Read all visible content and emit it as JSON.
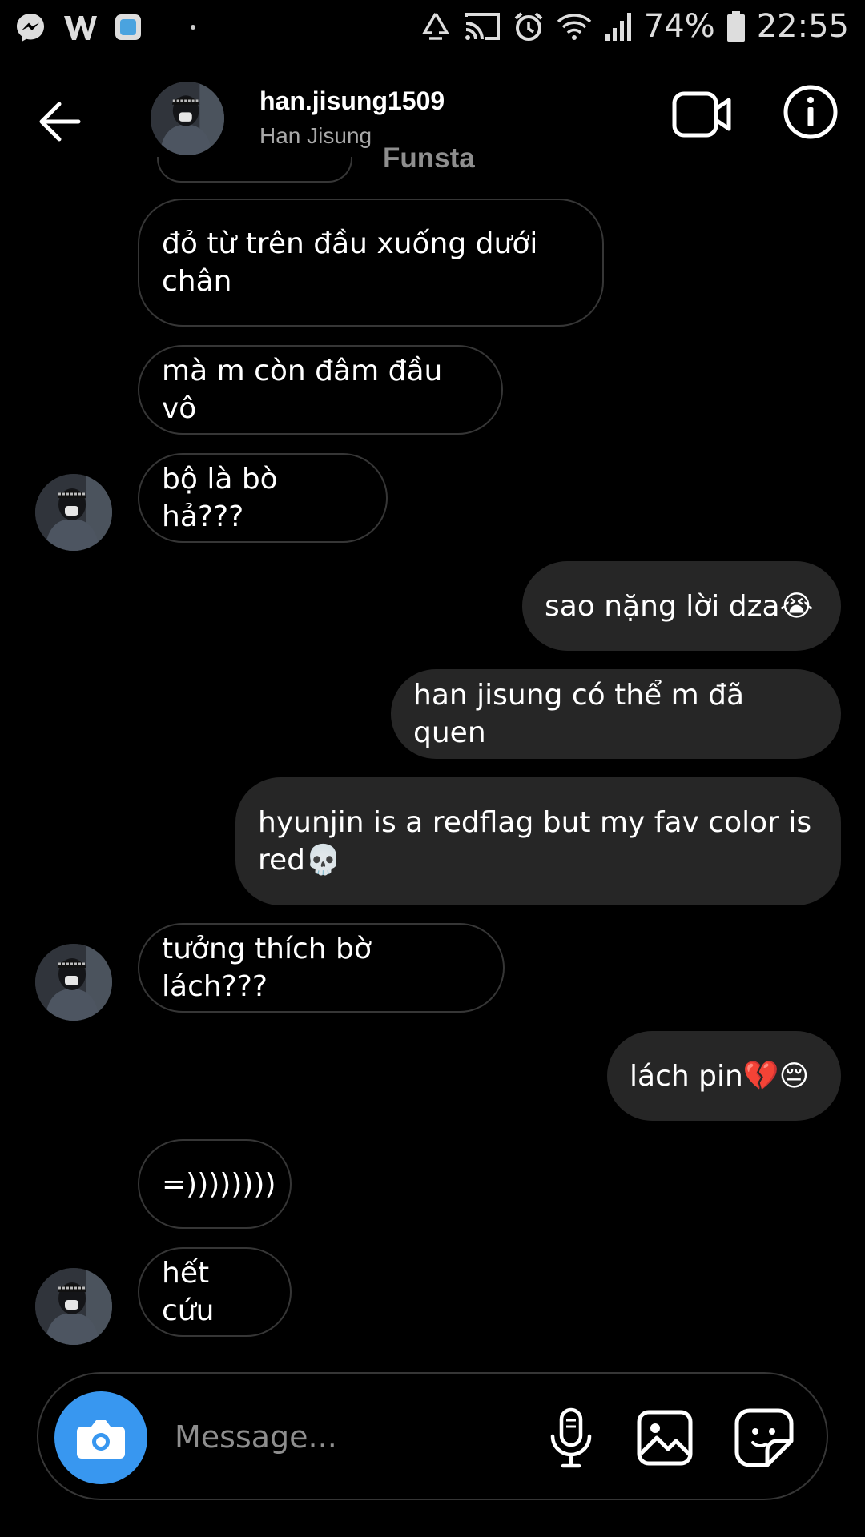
{
  "status_bar": {
    "battery_percent": "74%",
    "time": "22:55",
    "icons": [
      "messenger-icon",
      "w-app-icon",
      "image-app-icon",
      "recycle-icon",
      "cast-icon",
      "alarm-icon",
      "wifi-icon",
      "signal-icon",
      "battery-icon"
    ]
  },
  "header": {
    "username": "han.jisung1509",
    "full_name": "Han Jisung",
    "overlay_label": "Funsta"
  },
  "messages": [
    {
      "direction": "in",
      "text": "đỏ từ trên đầu xuống dưới chân",
      "avatar": false
    },
    {
      "direction": "in",
      "text": "mà m còn đâm đầu vô",
      "avatar": false
    },
    {
      "direction": "in",
      "text": "bộ là bò hả???",
      "avatar": true
    },
    {
      "direction": "out",
      "text": "sao nặng lời dza😭"
    },
    {
      "direction": "out",
      "text": "han jisung có thể m đã quen"
    },
    {
      "direction": "out",
      "text": "hyunjin is a redflag but my fav color is red💀"
    },
    {
      "direction": "in",
      "text": "tưởng thích bờ lách???",
      "avatar": true
    },
    {
      "direction": "out",
      "text": "lách pin💔😔"
    },
    {
      "direction": "in",
      "text": "=))))))))",
      "avatar": false
    },
    {
      "direction": "in",
      "text": "hết cứu",
      "avatar": true
    }
  ],
  "composer": {
    "placeholder": "Message..."
  },
  "colors": {
    "background": "#000000",
    "outgoing_bubble": "#262626",
    "incoming_border": "#363636",
    "camera_button": "#3897f0",
    "secondary_text": "#a8a8a8"
  }
}
